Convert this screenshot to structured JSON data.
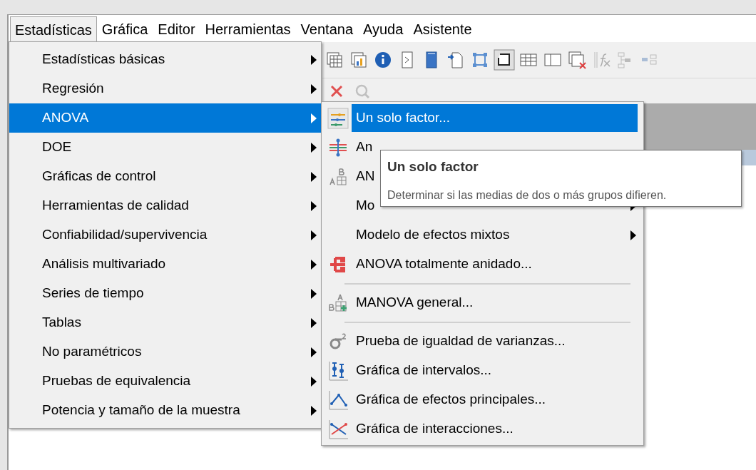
{
  "menu_bar": [
    {
      "label": "Estadísticas",
      "selected": true
    },
    {
      "label": "Gráfica",
      "selected": false
    },
    {
      "label": "Editor",
      "selected": false
    },
    {
      "label": "Herramientas",
      "selected": false
    },
    {
      "label": "Ventana",
      "selected": false
    },
    {
      "label": "Ayuda",
      "selected": false
    },
    {
      "label": "Asistente",
      "selected": false
    }
  ],
  "menu": {
    "items": [
      {
        "label": "Estadísticas básicas",
        "selected": false
      },
      {
        "label": "Regresión",
        "selected": false
      },
      {
        "label": "ANOVA",
        "selected": true
      },
      {
        "label": "DOE",
        "selected": false
      },
      {
        "label": "Gráficas de control",
        "selected": false
      },
      {
        "label": "Herramientas de calidad",
        "selected": false
      },
      {
        "label": "Confiabilidad/supervivencia",
        "selected": false
      },
      {
        "label": "Análisis multivariado",
        "selected": false
      },
      {
        "label": "Series de tiempo",
        "selected": false
      },
      {
        "label": "Tablas",
        "selected": false
      },
      {
        "label": "No paramétricos",
        "selected": false
      },
      {
        "label": "Pruebas de equivalencia",
        "selected": false
      },
      {
        "label": "Potencia y tamaño de la muestra",
        "selected": false
      }
    ]
  },
  "submenu": {
    "items": [
      {
        "kind": "item",
        "label": "Un solo factor...",
        "selected": true,
        "has_submenu": false
      },
      {
        "kind": "item",
        "label": "An",
        "selected": false
      },
      {
        "kind": "item",
        "label": "AN",
        "selected": false
      },
      {
        "kind": "item",
        "label": "Mo",
        "selected": false,
        "has_submenu": true
      },
      {
        "kind": "item",
        "label": "Modelo de efectos mixtos",
        "selected": false,
        "has_submenu": true
      },
      {
        "kind": "item",
        "label": "ANOVA totalmente anidado...",
        "selected": false,
        "has_submenu": false
      },
      {
        "kind": "separator"
      },
      {
        "kind": "item",
        "label": "MANOVA general...",
        "selected": false,
        "has_submenu": false
      },
      {
        "kind": "separator"
      },
      {
        "kind": "item",
        "label": "Prueba de igualdad de varianzas...",
        "selected": false,
        "has_submenu": false
      },
      {
        "kind": "item",
        "label": "Gráfica de intervalos...",
        "selected": false,
        "has_submenu": false
      },
      {
        "kind": "item",
        "label": "Gráfica de efectos principales...",
        "selected": false,
        "has_submenu": false
      },
      {
        "kind": "item",
        "label": "Gráfica de interacciones...",
        "selected": false,
        "has_submenu": false
      }
    ]
  },
  "tooltip": {
    "title": "Un solo factor",
    "text": "Determinar si las medias de dos o más grupos difieren."
  }
}
